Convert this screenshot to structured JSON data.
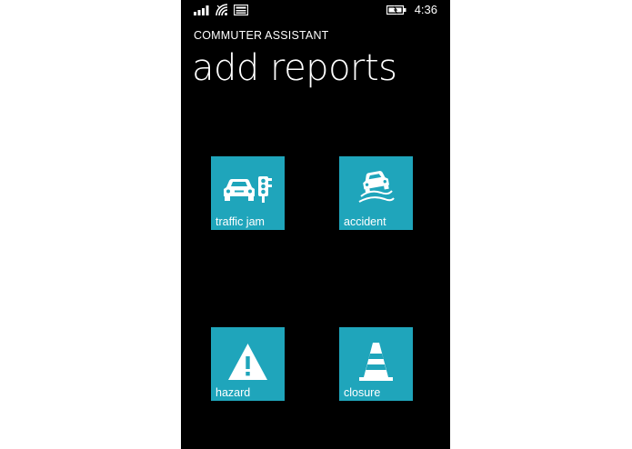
{
  "status_bar": {
    "icons": [
      "signal-icon",
      "wifi-icon",
      "message-icon",
      "battery-icon"
    ],
    "time": "4:36"
  },
  "app": {
    "title": "COMMUTER ASSISTANT",
    "page_title": "add reports"
  },
  "tiles": [
    {
      "label": "traffic jam",
      "icon": "traffic-jam-icon"
    },
    {
      "label": "accident",
      "icon": "accident-icon"
    },
    {
      "label": "hazard",
      "icon": "hazard-icon"
    },
    {
      "label": "closure",
      "icon": "closure-icon"
    }
  ],
  "colors": {
    "background": "#000000",
    "tile_accent": "#1fa5bb",
    "text": "#ffffff"
  }
}
